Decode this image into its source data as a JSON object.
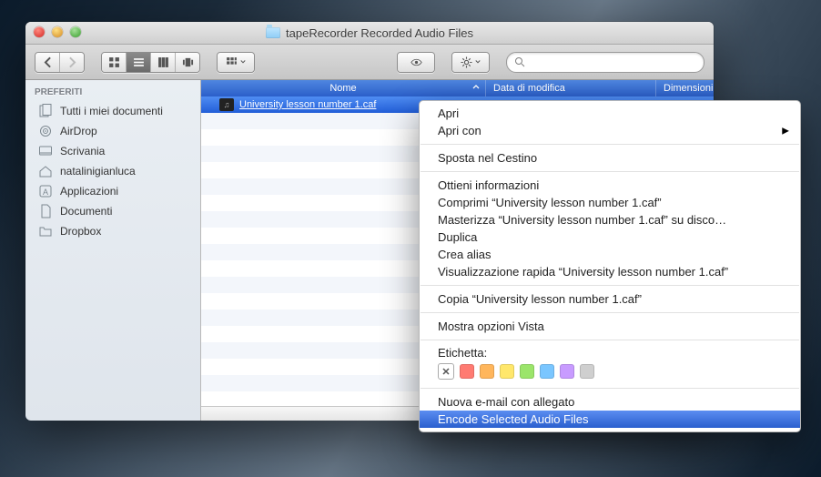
{
  "window": {
    "title": "tapeRecorder Recorded Audio Files"
  },
  "search": {
    "placeholder": ""
  },
  "sidebar": {
    "header": "PREFERITI",
    "items": [
      {
        "label": "Tutti i miei documenti",
        "icon": "all-docs-icon"
      },
      {
        "label": "AirDrop",
        "icon": "airdrop-icon"
      },
      {
        "label": "Scrivania",
        "icon": "desktop-icon"
      },
      {
        "label": "natalinigianluca",
        "icon": "home-icon"
      },
      {
        "label": "Applicazioni",
        "icon": "applications-icon"
      },
      {
        "label": "Documenti",
        "icon": "documents-icon"
      },
      {
        "label": "Dropbox",
        "icon": "folder-icon"
      }
    ]
  },
  "columns": {
    "name": "Nome",
    "date": "Data di modifica",
    "size": "Dimensioni"
  },
  "files": [
    {
      "name": "University lesson number 1.caf"
    }
  ],
  "context_menu": {
    "open": "Apri",
    "open_with": "Apri con",
    "trash": "Sposta nel Cestino",
    "info": "Ottieni informazioni",
    "compress": "Comprimi “University lesson number 1.caf”",
    "burn": "Masterizza “University lesson number 1.caf” su disco…",
    "duplicate": "Duplica",
    "alias": "Crea alias",
    "quicklook": "Visualizzazione rapida “University lesson number 1.caf”",
    "copy": "Copia “University lesson number 1.caf”",
    "view_opts": "Mostra opzioni Vista",
    "label_hdr": "Etichetta:",
    "email": "Nuova e-mail con allegato",
    "encode": "Encode Selected Audio Files",
    "label_colors": [
      "#ff7b72",
      "#ffb65c",
      "#ffe76b",
      "#9be56b",
      "#7ac6ff",
      "#c89bff",
      "#cfcfcf"
    ]
  }
}
